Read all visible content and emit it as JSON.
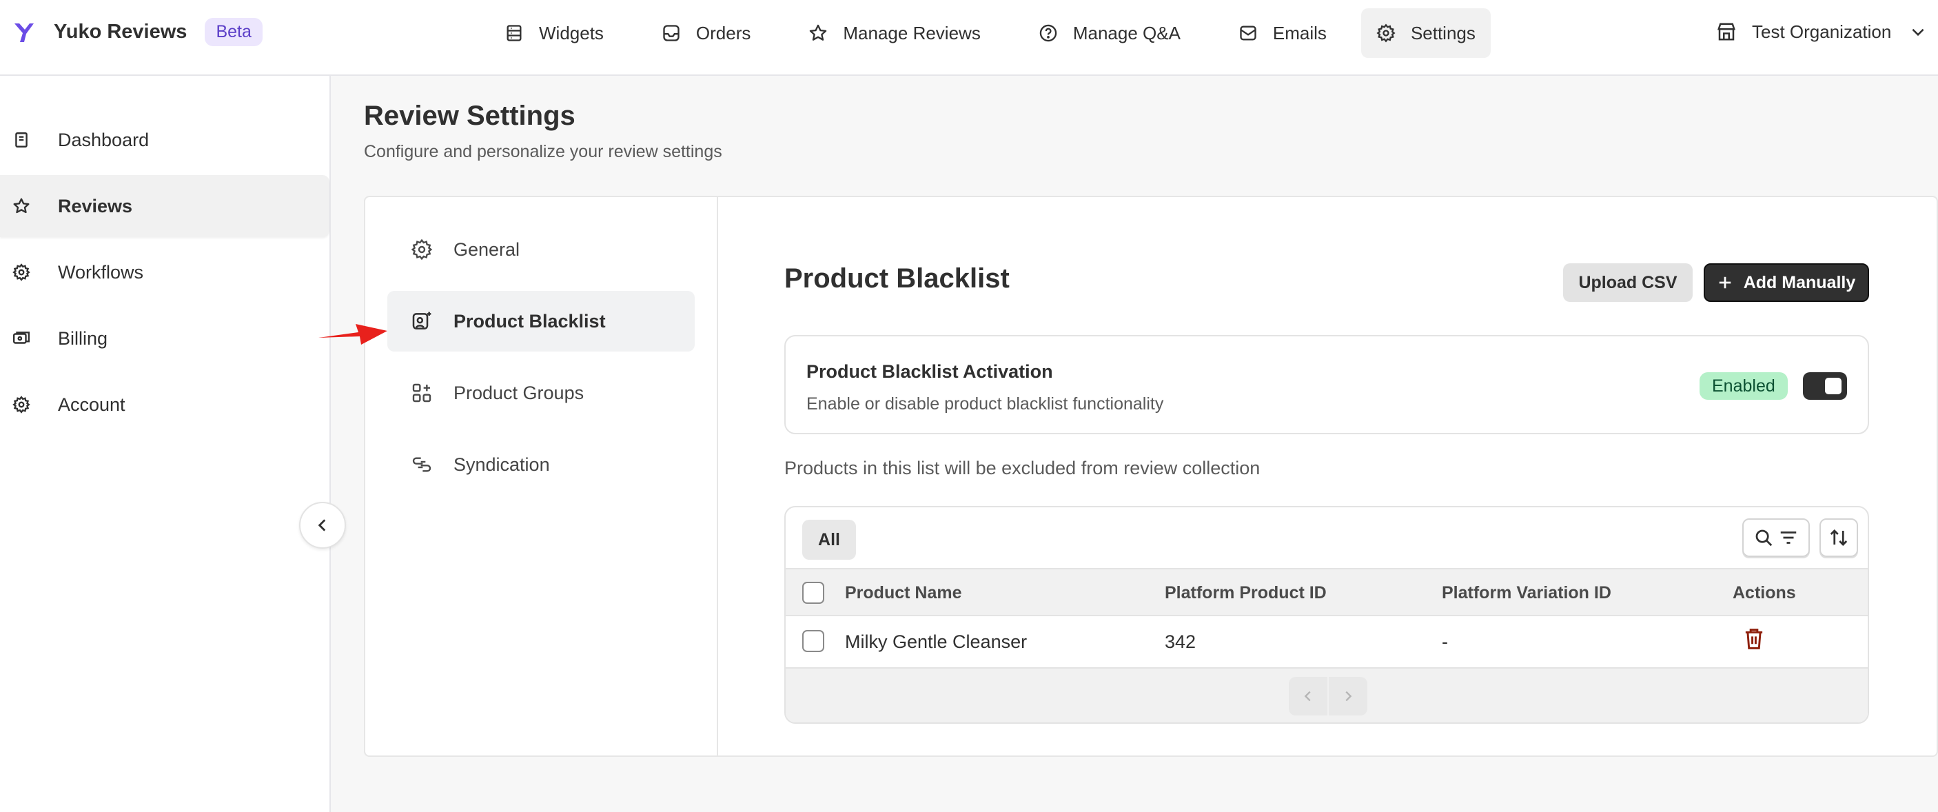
{
  "brand": {
    "name": "Yuko Reviews",
    "badge": "Beta"
  },
  "nav": {
    "items": [
      {
        "label": "Widgets",
        "icon": "widgets-icon"
      },
      {
        "label": "Orders",
        "icon": "inbox-icon"
      },
      {
        "label": "Manage Reviews",
        "icon": "star-icon"
      },
      {
        "label": "Manage Q&A",
        "icon": "question-circle-icon"
      },
      {
        "label": "Emails",
        "icon": "email-icon"
      },
      {
        "label": "Settings",
        "icon": "gear-icon",
        "active": true
      }
    ],
    "organization": "Test Organization"
  },
  "sidebar": {
    "items": [
      {
        "label": "Dashboard",
        "icon": "book-icon"
      },
      {
        "label": "Reviews",
        "icon": "star-icon",
        "active": true
      },
      {
        "label": "Workflows",
        "icon": "gear-icon"
      },
      {
        "label": "Billing",
        "icon": "credit-card-icon"
      },
      {
        "label": "Account",
        "icon": "gear-icon"
      }
    ]
  },
  "page": {
    "title": "Review Settings",
    "subtitle": "Configure and personalize your review settings"
  },
  "settings_menu": {
    "items": [
      {
        "label": "General",
        "icon": "gear-icon"
      },
      {
        "label": "Product Blacklist",
        "icon": "product-blacklist-icon",
        "active": true
      },
      {
        "label": "Product Groups",
        "icon": "apps-icon"
      },
      {
        "label": "Syndication",
        "icon": "link-icon"
      }
    ]
  },
  "content": {
    "title": "Product Blacklist",
    "upload_label": "Upload CSV",
    "add_label": "Add Manually",
    "activation": {
      "title": "Product Blacklist Activation",
      "description": "Enable or disable product blacklist functionality",
      "status": "Enabled",
      "enabled": true
    },
    "info": "Products in this list will be excluded from review collection",
    "table": {
      "tab_all": "All",
      "columns": [
        "Product Name",
        "Platform Product ID",
        "Platform Variation ID",
        "Actions"
      ],
      "rows": [
        {
          "product_name": "Milky Gentle Cleanser",
          "product_id": "342",
          "variation_id": "-"
        }
      ]
    }
  },
  "colors": {
    "accent": "#303030",
    "brand": "#6b4ce6",
    "badge_bg": "#ece6fd",
    "enabled_bg": "#b4f0c8",
    "danger": "#8e1f0b",
    "annotation_arrow": "#e8211c"
  }
}
